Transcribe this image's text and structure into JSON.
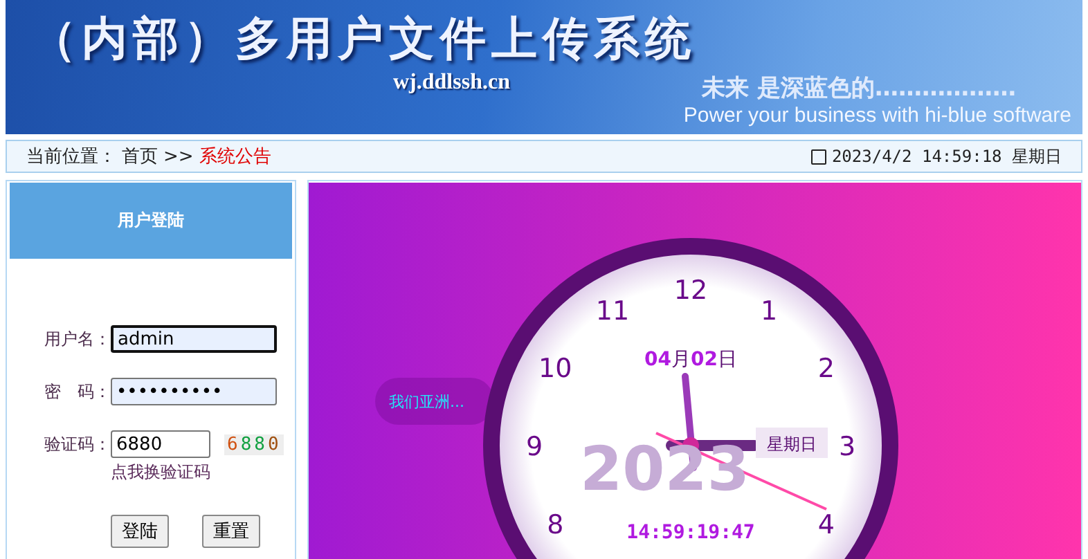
{
  "banner": {
    "title": "（内部）多用户文件上传系统",
    "domain": "wj.ddlssh.cn",
    "slogan": "未来 是深蓝色的………………",
    "slogan_en": "Power your business with hi-blue software"
  },
  "breadcrumb": {
    "label": "当前位置：",
    "home": "首页",
    "separator": ">>",
    "current": "系统公告",
    "datetime": "2023/4/2 14:59:18 星期日"
  },
  "login": {
    "title": "用户登陆",
    "fields": [
      {
        "kind": "text",
        "label": "用户名：",
        "value": "admin",
        "focused": true
      },
      {
        "kind": "password",
        "label": "密　码：",
        "value": "••••••••••",
        "focused": false
      },
      {
        "kind": "captcha",
        "label": "验证码：",
        "value": "6880",
        "focused": false
      }
    ],
    "captcha_digits": [
      {
        "text": "6",
        "color": "#d05010"
      },
      {
        "text": "8",
        "color": "#10a040"
      },
      {
        "text": "8",
        "color": "#10a040"
      },
      {
        "text": "0",
        "color": "#a05010"
      }
    ],
    "refresh_link": "点我换验证码",
    "buttons": [
      "登陆",
      "重置"
    ]
  },
  "clock": {
    "bubble": "我们亚洲...",
    "numbers": [
      "12",
      "1",
      "2",
      "3",
      "4",
      "8",
      "9",
      "10",
      "11"
    ],
    "month": "04",
    "month_unit": "月",
    "day": "02",
    "day_unit": "日",
    "year": "2023",
    "weekday": "星期日",
    "time": "14:59:19:47"
  }
}
